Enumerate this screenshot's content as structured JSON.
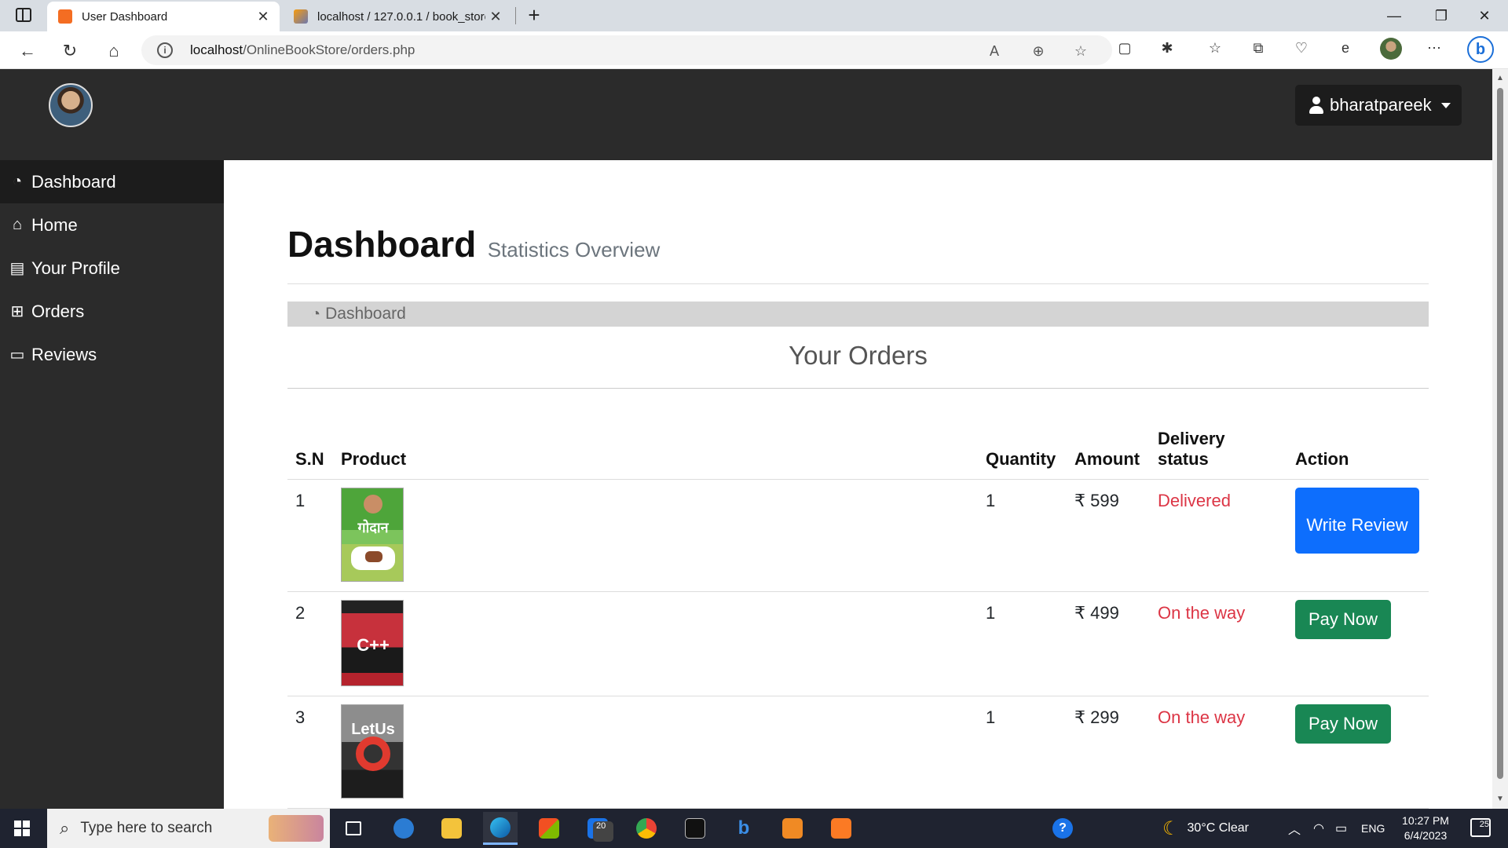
{
  "browser": {
    "tabs": [
      {
        "title": "User Dashboard",
        "active": true
      },
      {
        "title": "localhost / 127.0.0.1 / book_store",
        "active": false
      }
    ],
    "url_host": "localhost",
    "url_path": "/OnlineBookStore/orders.php"
  },
  "topnav": {
    "username": "bharatpareek"
  },
  "sidebar": {
    "items": [
      {
        "label": "Dashboard",
        "icon": "dashboard-icon",
        "active": true
      },
      {
        "label": "Home",
        "icon": "home-icon"
      },
      {
        "label": "Your Profile",
        "icon": "bar-chart-icon"
      },
      {
        "label": "Orders",
        "icon": "table-icon"
      },
      {
        "label": "Reviews",
        "icon": "desktop-icon"
      }
    ]
  },
  "header": {
    "title": "Dashboard",
    "subtitle": "Statistics Overview"
  },
  "breadcrumb": {
    "label": "Dashboard"
  },
  "orders": {
    "title": "Your Orders",
    "columns": [
      "S.N",
      "Product",
      "Quantity",
      "Amount",
      "Delivery status",
      "Action"
    ],
    "rows": [
      {
        "sn": "1",
        "product_cover": "godan-book-cover",
        "quantity": "1",
        "amount": "₹ 599",
        "status": "Delivered",
        "action": "Write Review"
      },
      {
        "sn": "2",
        "product_cover": "let-us-cpp-book-cover",
        "quantity": "1",
        "amount": "₹ 499",
        "status": "On the way",
        "action": "Pay Now"
      },
      {
        "sn": "3",
        "product_cover": "let-us-c-book-cover",
        "quantity": "1",
        "amount": "₹ 299",
        "status": "On the way",
        "action": "Pay Now"
      }
    ],
    "colors": {
      "status": "#dc3545",
      "primary": "#0d6efd",
      "success": "#198754"
    }
  },
  "taskbar": {
    "search_placeholder": "Type here to search",
    "mail_badge": "20",
    "weather": "30°C  Clear",
    "language": "ENG",
    "time": "10:27 PM",
    "date": "6/4/2023",
    "notifications": "25"
  }
}
